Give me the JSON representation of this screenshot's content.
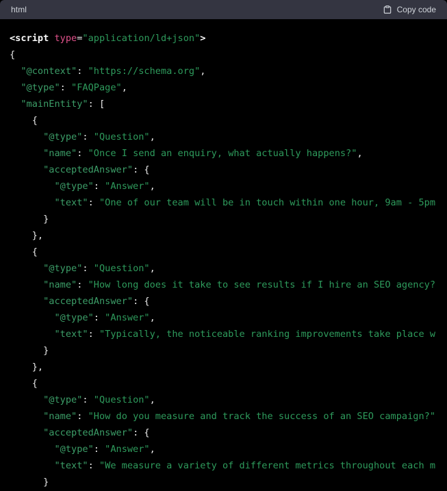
{
  "header": {
    "language_label": "html",
    "copy_label": "Copy code",
    "copy_icon": "clipboard-icon"
  },
  "colors": {
    "header_background": "#343541",
    "code_background": "#000000",
    "header_text": "#d1d5db",
    "string_green": "#2e9b5c",
    "key_green": "#3c9e68",
    "attribute_pink": "#e0528b",
    "punctuation_white": "#e8e8e8"
  },
  "code": {
    "language": "html",
    "lines": [
      [
        {
          "t": "tag",
          "v": "<script"
        },
        {
          "t": "plain",
          "v": " "
        },
        {
          "t": "attr",
          "v": "type"
        },
        {
          "t": "op",
          "v": "="
        },
        {
          "t": "str",
          "v": "\"application/ld+json\""
        },
        {
          "t": "tag",
          "v": ">"
        }
      ],
      [
        {
          "t": "punc",
          "v": "{"
        }
      ],
      [
        {
          "t": "key",
          "v": "  \"@context\""
        },
        {
          "t": "punc",
          "v": ":"
        },
        {
          "t": "str",
          "v": " \"https://schema.org\""
        },
        {
          "t": "punc",
          "v": ","
        }
      ],
      [
        {
          "t": "key",
          "v": "  \"@type\""
        },
        {
          "t": "punc",
          "v": ":"
        },
        {
          "t": "str",
          "v": " \"FAQPage\""
        },
        {
          "t": "punc",
          "v": ","
        }
      ],
      [
        {
          "t": "key",
          "v": "  \"mainEntity\""
        },
        {
          "t": "punc",
          "v": ": ["
        }
      ],
      [
        {
          "t": "punc",
          "v": "    {"
        }
      ],
      [
        {
          "t": "key",
          "v": "      \"@type\""
        },
        {
          "t": "punc",
          "v": ":"
        },
        {
          "t": "str",
          "v": " \"Question\""
        },
        {
          "t": "punc",
          "v": ","
        }
      ],
      [
        {
          "t": "key",
          "v": "      \"name\""
        },
        {
          "t": "punc",
          "v": ":"
        },
        {
          "t": "str",
          "v": " \"Once I send an enquiry, what actually happens?\""
        },
        {
          "t": "punc",
          "v": ","
        }
      ],
      [
        {
          "t": "key",
          "v": "      \"acceptedAnswer\""
        },
        {
          "t": "punc",
          "v": ": {"
        }
      ],
      [
        {
          "t": "key",
          "v": "        \"@type\""
        },
        {
          "t": "punc",
          "v": ":"
        },
        {
          "t": "str",
          "v": " \"Answer\""
        },
        {
          "t": "punc",
          "v": ","
        }
      ],
      [
        {
          "t": "key",
          "v": "        \"text\""
        },
        {
          "t": "punc",
          "v": ":"
        },
        {
          "t": "str",
          "v": " \"One of our team will be in touch within one hour, 9am - 5pm"
        }
      ],
      [
        {
          "t": "punc",
          "v": "      }"
        }
      ],
      [
        {
          "t": "punc",
          "v": "    },"
        }
      ],
      [
        {
          "t": "punc",
          "v": "    {"
        }
      ],
      [
        {
          "t": "key",
          "v": "      \"@type\""
        },
        {
          "t": "punc",
          "v": ":"
        },
        {
          "t": "str",
          "v": " \"Question\""
        },
        {
          "t": "punc",
          "v": ","
        }
      ],
      [
        {
          "t": "key",
          "v": "      \"name\""
        },
        {
          "t": "punc",
          "v": ":"
        },
        {
          "t": "str",
          "v": " \"How long does it take to see results if I hire an SEO agency?"
        }
      ],
      [
        {
          "t": "key",
          "v": "      \"acceptedAnswer\""
        },
        {
          "t": "punc",
          "v": ": {"
        }
      ],
      [
        {
          "t": "key",
          "v": "        \"@type\""
        },
        {
          "t": "punc",
          "v": ":"
        },
        {
          "t": "str",
          "v": " \"Answer\""
        },
        {
          "t": "punc",
          "v": ","
        }
      ],
      [
        {
          "t": "key",
          "v": "        \"text\""
        },
        {
          "t": "punc",
          "v": ":"
        },
        {
          "t": "str",
          "v": " \"Typically, the noticeable ranking improvements take place w"
        }
      ],
      [
        {
          "t": "punc",
          "v": "      }"
        }
      ],
      [
        {
          "t": "punc",
          "v": "    },"
        }
      ],
      [
        {
          "t": "punc",
          "v": "    {"
        }
      ],
      [
        {
          "t": "key",
          "v": "      \"@type\""
        },
        {
          "t": "punc",
          "v": ":"
        },
        {
          "t": "str",
          "v": " \"Question\""
        },
        {
          "t": "punc",
          "v": ","
        }
      ],
      [
        {
          "t": "key",
          "v": "      \"name\""
        },
        {
          "t": "punc",
          "v": ":"
        },
        {
          "t": "str",
          "v": " \"How do you measure and track the success of an SEO campaign?\""
        }
      ],
      [
        {
          "t": "key",
          "v": "      \"acceptedAnswer\""
        },
        {
          "t": "punc",
          "v": ": {"
        }
      ],
      [
        {
          "t": "key",
          "v": "        \"@type\""
        },
        {
          "t": "punc",
          "v": ":"
        },
        {
          "t": "str",
          "v": " \"Answer\""
        },
        {
          "t": "punc",
          "v": ","
        }
      ],
      [
        {
          "t": "key",
          "v": "        \"text\""
        },
        {
          "t": "punc",
          "v": ":"
        },
        {
          "t": "str",
          "v": " \"We measure a variety of different metrics throughout each m"
        }
      ],
      [
        {
          "t": "punc",
          "v": "      }"
        }
      ]
    ]
  }
}
